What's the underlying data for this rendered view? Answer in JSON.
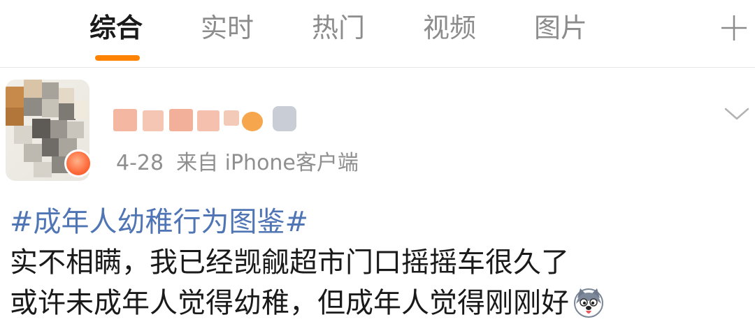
{
  "tabs": [
    {
      "label": "综合",
      "active": true
    },
    {
      "label": "实时",
      "active": false
    },
    {
      "label": "热门",
      "active": false
    },
    {
      "label": "视频",
      "active": false
    },
    {
      "label": "图片",
      "active": false
    }
  ],
  "icons": {
    "add_tab": "plus-icon",
    "menu": "chevron-down-icon",
    "emoji": "husky-dog-emoji"
  },
  "colors": {
    "accent": "#ff8200",
    "hashtag": "#5075b5",
    "meta_text": "#8f8f8f",
    "tab_inactive": "#8c8c8c"
  },
  "post": {
    "author": {
      "name": "(blurred)"
    },
    "date": "4-28",
    "source": "来自 iPhone客户端",
    "hashtag": "#成年人幼稚行为图鉴#",
    "line1": "实不相瞒，我已经觊觎超市门口摇摇车很久了",
    "line2": "或许未成年人觉得幼稚，但成年人觉得刚刚好"
  }
}
